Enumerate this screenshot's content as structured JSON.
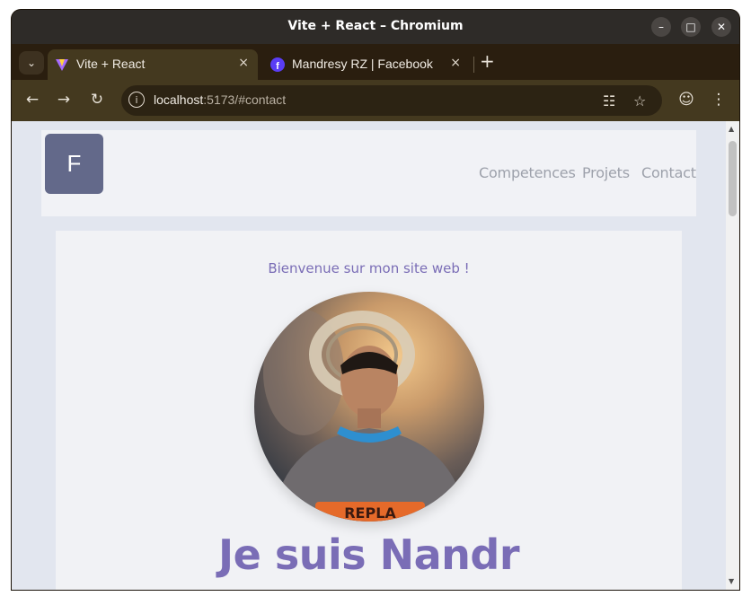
{
  "window": {
    "title": "Vite + React – Chromium"
  },
  "tabs": [
    {
      "label": "Vite + React",
      "active": true,
      "favicon": "vite-logo-icon"
    },
    {
      "label": "Mandresy RZ | Facebook",
      "active": false,
      "favicon": "facebook-icon"
    }
  ],
  "tab_close_glyph": "×",
  "new_tab_glyph": "+",
  "toolbar": {
    "url_host": "localhost",
    "url_path": ":5173/#contact"
  },
  "site": {
    "logo_letter": "F",
    "nav": [
      "Competences",
      "Projets",
      "Contact"
    ],
    "welcome": "Bienvenue sur mon site web !",
    "headline": "Je suis Nandr"
  },
  "colors": {
    "accent": "#7a6db6",
    "nav_text": "#9da1ab",
    "logo_bg": "#63698a",
    "page_bg": "#e2e6ef"
  }
}
